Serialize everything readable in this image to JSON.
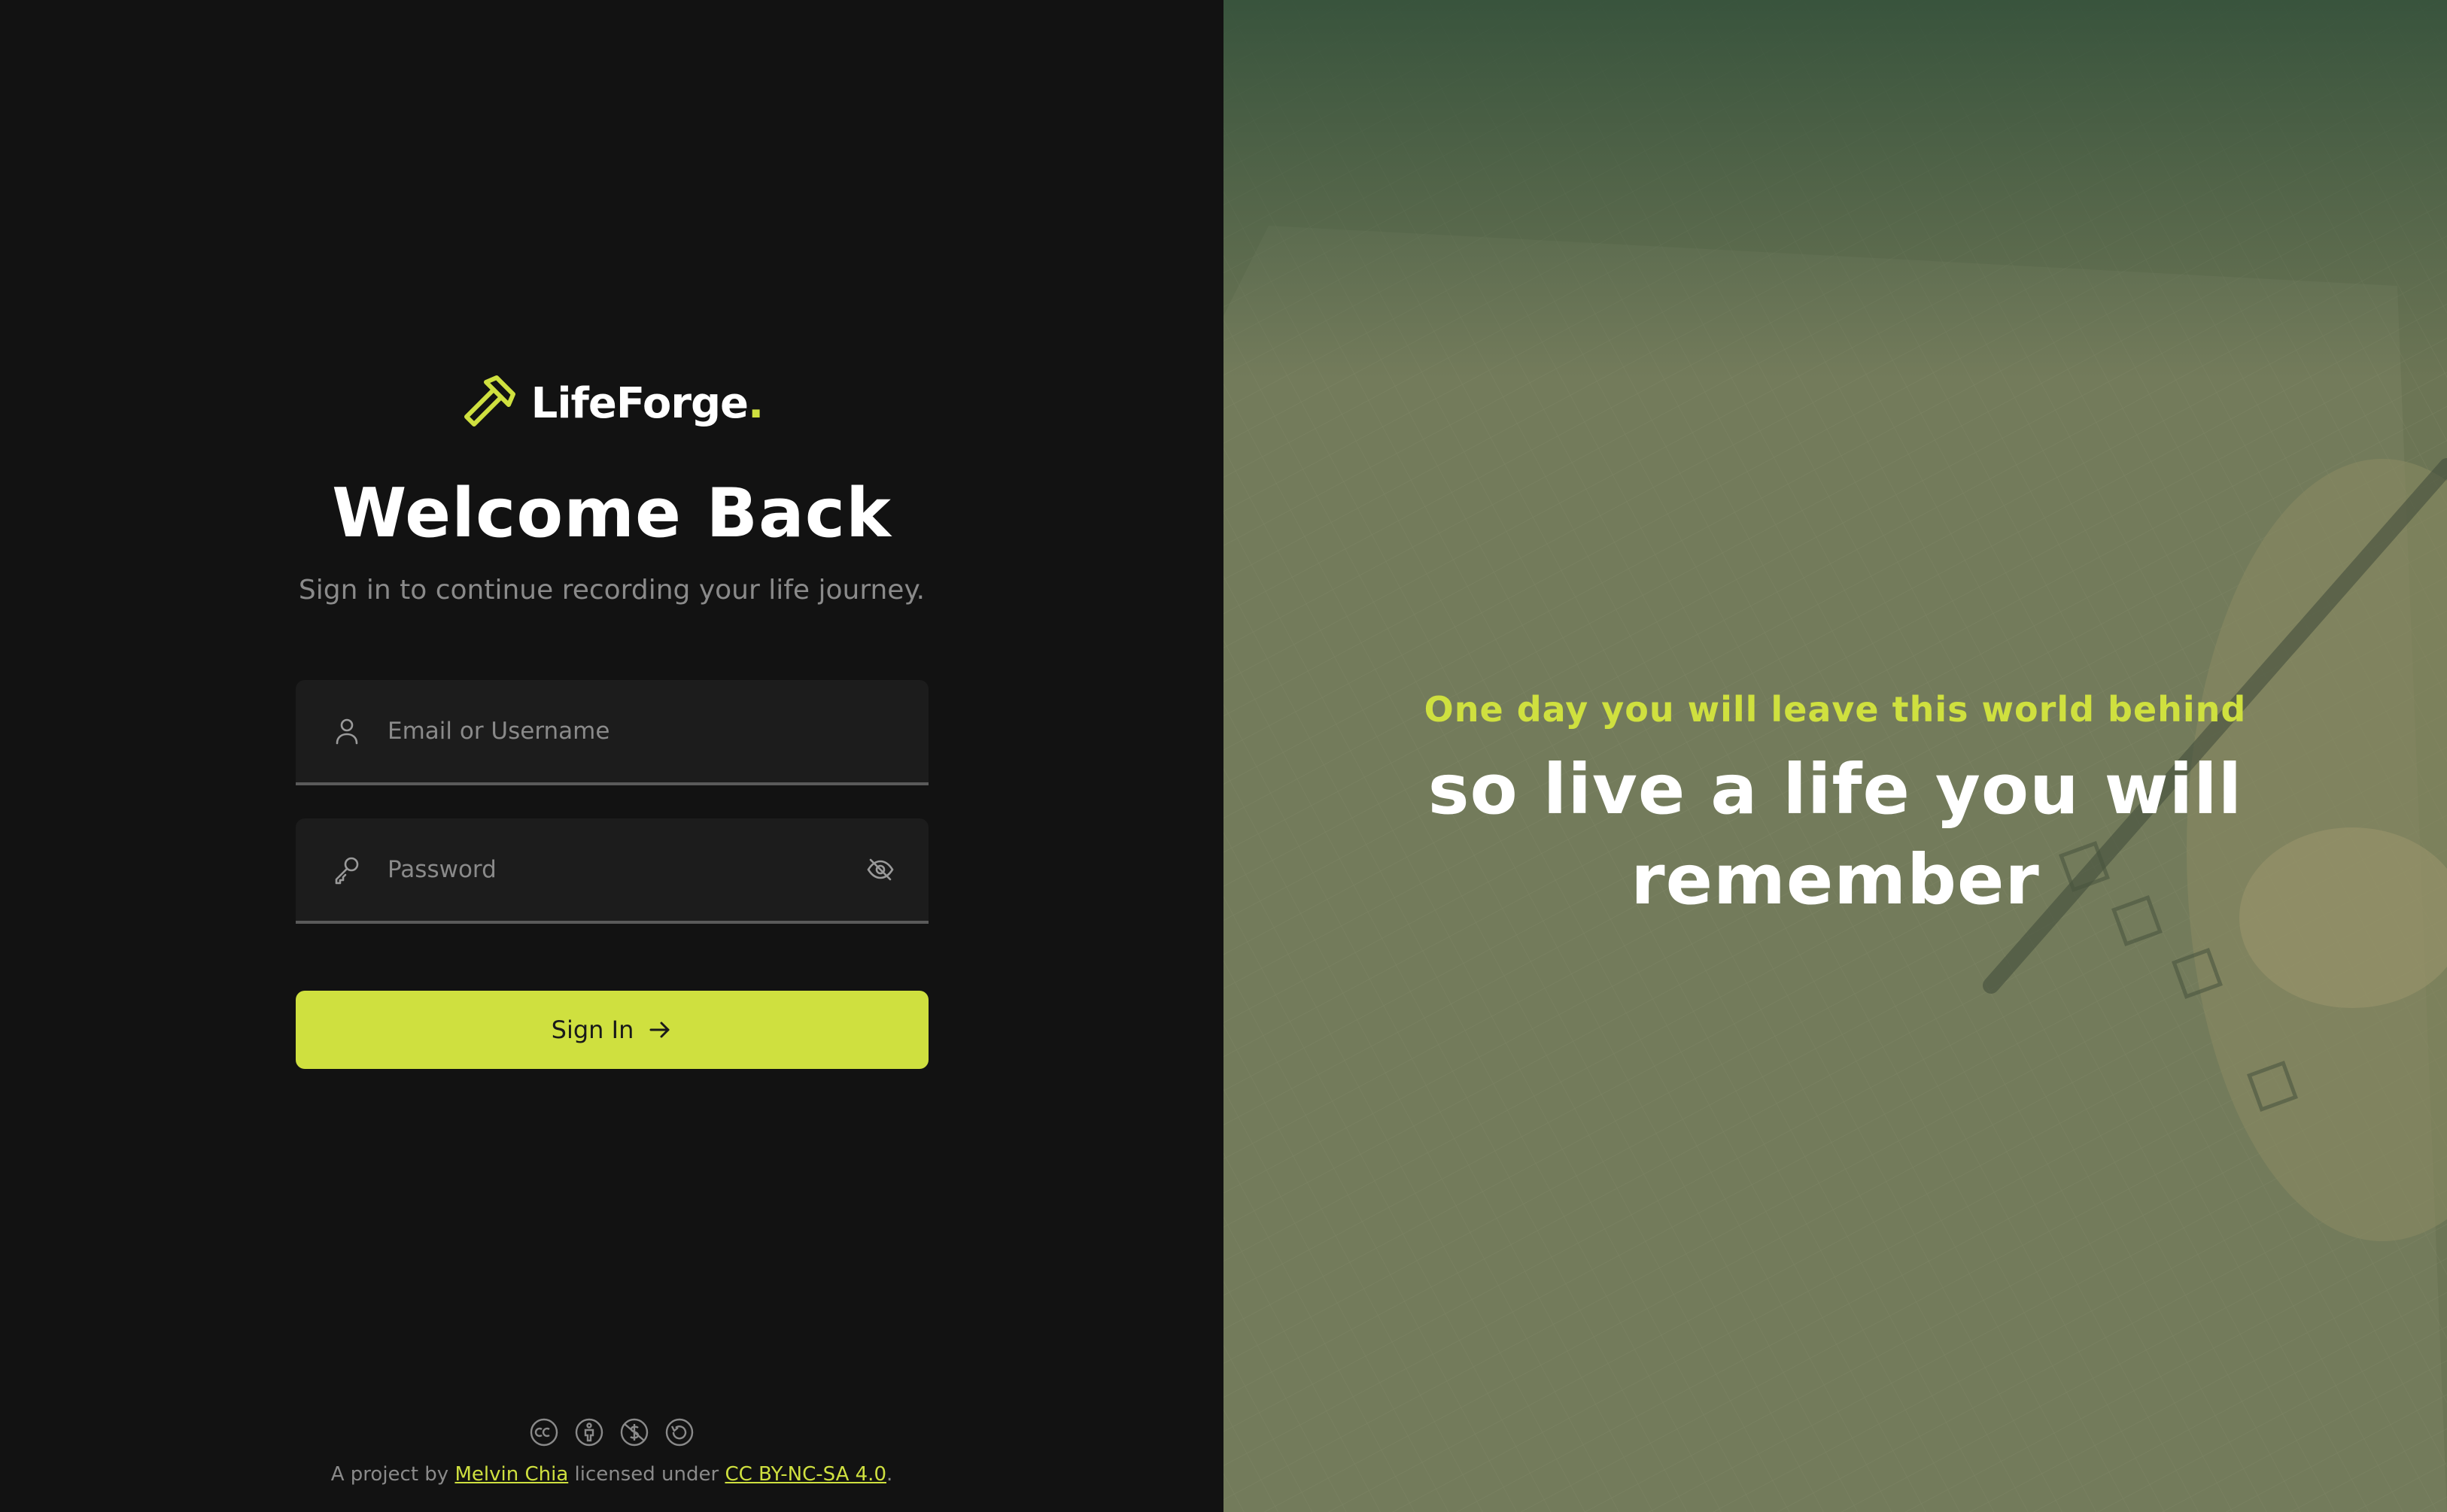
{
  "brand": {
    "name": "LifeForge",
    "dot": ".",
    "accent_color": "#cfe03f"
  },
  "login": {
    "title": "Welcome Back",
    "subtitle": "Sign in to continue recording your life journey.",
    "email_placeholder": "Email or Username",
    "email_value": "",
    "password_placeholder": "Password",
    "password_value": "",
    "signin_label": "Sign In"
  },
  "footer": {
    "prefix": "A project by ",
    "author": "Melvin Chia",
    "middle": " licensed under ",
    "license": "CC BY-NC-SA 4.0",
    "suffix": ".",
    "license_icons": [
      "cc-icon",
      "by-icon",
      "nc-icon",
      "sa-icon"
    ]
  },
  "quote": {
    "line1": "One day you will leave this world behind",
    "line2": "so live a life you will remember"
  },
  "icons": {
    "logo": "hammer-icon",
    "email": "user-icon",
    "password": "key-icon",
    "toggle_visibility": "eye-off-icon",
    "signin": "arrow-right-icon"
  }
}
